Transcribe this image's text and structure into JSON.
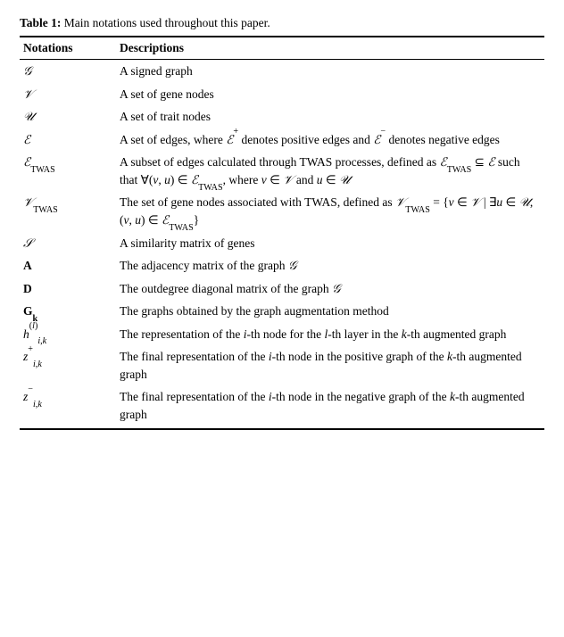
{
  "caption": {
    "label": "Table 1:",
    "text": " Main notations used throughout this paper."
  },
  "headers": {
    "col1": "Notations",
    "col2": "Descriptions"
  },
  "rows": [
    {
      "notation_html": "<span class='math-cal'>𝒢</span>",
      "description_html": "A signed graph"
    },
    {
      "notation_html": "<span class='math-cal'>𝒱</span>",
      "description_html": "A set of gene nodes"
    },
    {
      "notation_html": "<span class='math-cal'>𝒰</span>",
      "description_html": "A set of trait nodes"
    },
    {
      "notation_html": "<span class='math-cal'>ℰ</span>",
      "description_html": "A set of edges, where <span class='math-cal'>ℰ</span><sup>+</sup> denotes positive edges and <span class='math-cal'>ℰ</span><sup>−</sup> denotes negative edges"
    },
    {
      "notation_html": "<span class='math-cal'>ℰ</span><sub>TWAS</sub>",
      "description_html": "A subset of edges calculated through TWAS processes, defined as <span class='math-cal'>ℰ</span><sub>TWAS</sub> ⊆ <span class='math-cal'>ℰ</span> such that ∀(<span class='math'>v</span>, <span class='math'>u</span>) ∈ <span class='math-cal'>ℰ</span><sub>TWAS</sub>, where <span class='math'>v</span> ∈ <span class='math-cal'>𝒱</span> and <span class='math'>u</span> ∈ <span class='math-cal'>𝒰</span>"
    },
    {
      "notation_html": "<span class='math-cal'>𝒱</span><sub>TWAS</sub>",
      "description_html": "The set of gene nodes associated with TWAS, defined as <span class='math-cal'>𝒱</span><sub>TWAS</sub> = {<span class='math'>v</span> ∈ <span class='math-cal'>𝒱</span> | ∃<span class='math'>u</span> ∈ <span class='math-cal'>𝒰</span>, (<span class='math'>v</span>, <span class='math'>u</span>) ∈ <span class='math-cal'>ℰ</span><sub>TWAS</sub>}"
    },
    {
      "notation_html": "<span class='math-cal'>𝒮</span>",
      "description_html": "A similarity matrix of genes"
    },
    {
      "notation_html": "<span class='bold'>A</span>",
      "description_html": "The adjacency matrix of the graph <span class='math-cal'>𝒢</span>"
    },
    {
      "notation_html": "<span class='bold'>D</span>",
      "description_html": "The outdegree diagonal matrix of the graph <span class='math-cal'>𝒢</span>"
    },
    {
      "notation_html": "<span class='bold'>G</span><sub><span class='bold'>k</span></sub>",
      "description_html": "The graphs obtained by the graph augmentation method"
    },
    {
      "notation_html": "<span class='math'>h</span><sup>(<span class='math'>l</span>)</sup><sub><span class='math'>i</span>,<span class='math'>k</span></sub>",
      "description_html": "The representation of the <span class='math'>i</span>-th node for the <span class='math'>l</span>-th layer in the <span class='math'>k</span>-th augmented graph"
    },
    {
      "notation_html": "<span class='math'>z</span><sup>+</sup><sub><span class='math'>i</span>,<span class='math'>k</span></sub>",
      "description_html": "The final representation of the <span class='math'>i</span>-th node in the positive graph of the <span class='math'>k</span>-th augmented graph"
    },
    {
      "notation_html": "<span class='math'>z</span><sup>−</sup><sub><span class='math'>i</span>,<span class='math'>k</span></sub>",
      "description_html": "The final representation of the <span class='math'>i</span>-th node in the negative graph of the <span class='math'>k</span>-th augmented graph",
      "is_last": true
    }
  ]
}
